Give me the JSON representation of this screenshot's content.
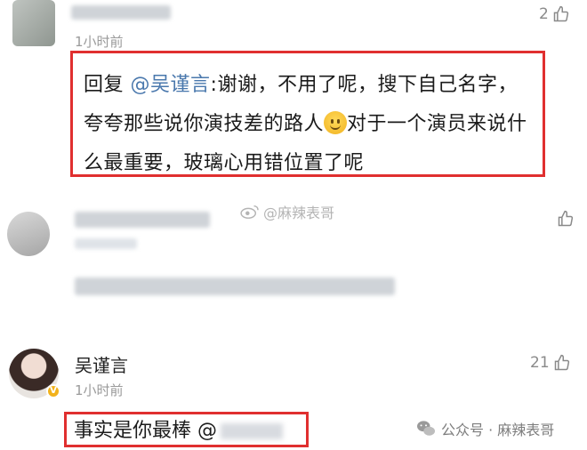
{
  "comment1": {
    "time": "1小时前",
    "likes": "2",
    "reply_prefix": "回复",
    "mention": "@吴谨言",
    "reply_text": ":谢谢，不用了呢，搜下自己名字，夸夸那些说你演技差的路人",
    "reply_text2": "对于一个演员来说什么最重要，玻璃心用错位置了呢"
  },
  "watermark_mid": {
    "text": "@麻辣表哥"
  },
  "comment3": {
    "name": "吴谨言",
    "time": "1小时前",
    "likes": "21",
    "text": "事实是你最棒",
    "mention": "@"
  },
  "watermark_bottom": {
    "text": "公众号 · 麻辣表哥"
  },
  "colors": {
    "highlight_border": "#e02f2f",
    "mention": "#4a78ad"
  }
}
